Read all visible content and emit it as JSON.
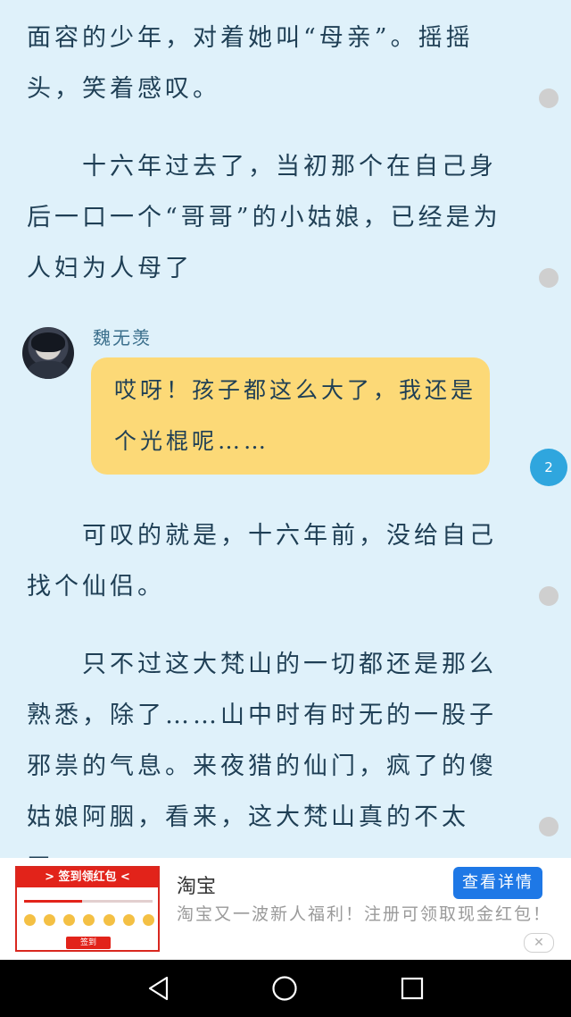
{
  "reader": {
    "paragraphs": [
      "面容的少年，对着她叫“母亲”。摇摇头，笑着感叹。",
      "十六年过去了，当初那个在自己身后一口一个“哥哥”的小姑娘，已经是为人妇为人母了",
      "可叹的就是，十六年前，没给自己找个仙侣。",
      "只不过这大梵山的一切都还是那么熟悉，除了……山中时有时无的一股子邪祟的气息。来夜猎的仙门，疯了的傻姑娘阿胭，看来，这大梵山真的不太平。"
    ],
    "dialogue": {
      "speaker": "魏无羡",
      "text": "哎呀！孩子都这么大了，我还是个光棍呢……"
    },
    "comment_badge": "2"
  },
  "ad": {
    "image_banner": "> 签到领红包 <",
    "image_cta": "签到",
    "title": "淘宝",
    "description": "淘宝又一波新人福利！注册可领取现金红包！",
    "button": "查看详情",
    "close": "✕"
  },
  "colors": {
    "background": "#dff1fa",
    "bubble": "#fcd977",
    "badge": "#2fa6de",
    "ad_button": "#1e78e6"
  },
  "icons": [
    "back-icon",
    "home-icon",
    "recent-apps-icon",
    "close-icon"
  ]
}
